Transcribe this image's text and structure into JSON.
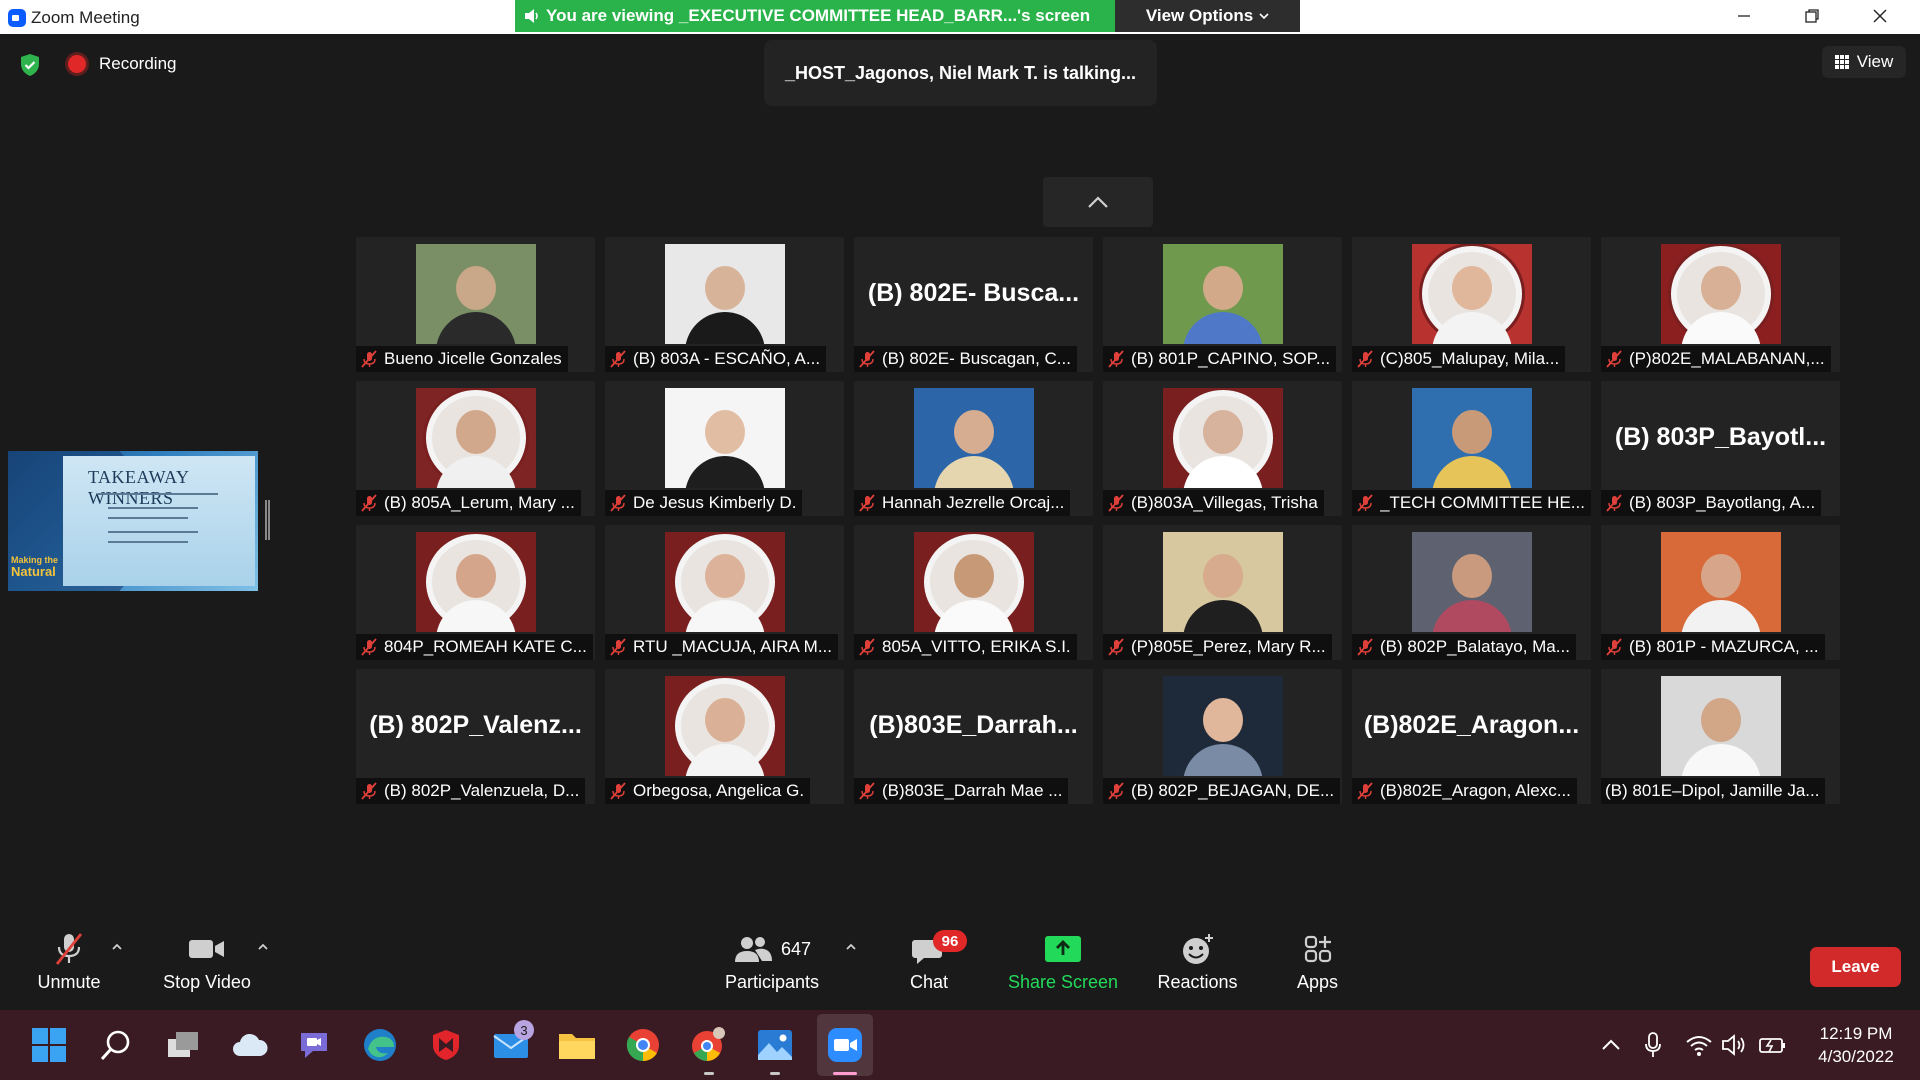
{
  "window": {
    "app_title": "Zoom Meeting",
    "viewing_banner": "You are viewing _EXECUTIVE COMMITTEE HEAD_BARR...'s screen",
    "view_options_label": "View Options",
    "minimize_icon": "minimize-icon",
    "maximize_icon": "restore-icon",
    "close_icon": "close-icon"
  },
  "overlay": {
    "recording_label": "Recording",
    "talking_text": "_HOST_Jagonos, Niel Mark T. is talking...",
    "view_label": "View"
  },
  "share_thumbnail": {
    "title": "TAKEAWAY WINNERS",
    "brand_line1": "Making the",
    "brand_line2": "Natural"
  },
  "participants": [
    {
      "name": "Bueno Jicelle Gonzales",
      "muted": true,
      "avatar": "photo"
    },
    {
      "name": "(B) 803A - ESCAÑO, A...",
      "muted": true,
      "avatar": "photo"
    },
    {
      "name": "(B) 802E- Buscagan, C...",
      "muted": true,
      "avatar": "text",
      "big_name": "(B) 802E- Busca..."
    },
    {
      "name": "(B) 801P_CAPINO, SOP...",
      "muted": true,
      "avatar": "photo"
    },
    {
      "name": "(C)805_Malupay, Mila...",
      "muted": true,
      "avatar": "photo"
    },
    {
      "name": "(P)802E_MALABANAN,...",
      "muted": true,
      "avatar": "photo"
    },
    {
      "name": "(B) 805A_Lerum, Mary ...",
      "muted": true,
      "avatar": "photo"
    },
    {
      "name": "De Jesus Kimberly D.",
      "muted": true,
      "avatar": "photo"
    },
    {
      "name": "Hannah Jezrelle Orcaj...",
      "muted": true,
      "avatar": "photo"
    },
    {
      "name": "(B)803A_Villegas, Trisha",
      "muted": true,
      "avatar": "photo"
    },
    {
      "name": "_TECH COMMITTEE HE...",
      "muted": true,
      "avatar": "photo"
    },
    {
      "name": "(B) 803P_Bayotlang, A...",
      "muted": true,
      "avatar": "text",
      "big_name": "(B)  803P_Bayotl..."
    },
    {
      "name": "804P_ROMEAH KATE C...",
      "muted": true,
      "avatar": "photo"
    },
    {
      "name": "RTU _MACUJA, AIRA M...",
      "muted": true,
      "avatar": "photo"
    },
    {
      "name": "805A_VITTO, ERIKA S.I.",
      "muted": true,
      "avatar": "photo"
    },
    {
      "name": "(P)805E_Perez, Mary R...",
      "muted": true,
      "avatar": "photo"
    },
    {
      "name": "(B) 802P_Balatayo, Ma...",
      "muted": true,
      "avatar": "photo"
    },
    {
      "name": "(B) 801P - MAZURCA, ...",
      "muted": true,
      "avatar": "photo"
    },
    {
      "name": "(B) 802P_Valenzuela, D...",
      "muted": true,
      "avatar": "text",
      "big_name": "(B)  802P_Valenz..."
    },
    {
      "name": "Orbegosa, Angelica G.",
      "muted": true,
      "avatar": "photo"
    },
    {
      "name": "(B)803E_Darrah Mae ...",
      "muted": true,
      "avatar": "text",
      "big_name": "(B)803E_Darrah..."
    },
    {
      "name": "(B) 802P_BEJAGAN, DE...",
      "muted": true,
      "avatar": "photo"
    },
    {
      "name": "(B)802E_Aragon, Alexc...",
      "muted": true,
      "avatar": "text",
      "big_name": "(B)802E_Aragon..."
    },
    {
      "name": "(B) 801E–Dipol, Jamille Ja...",
      "muted": false,
      "avatar": "photo"
    }
  ],
  "toolbar": {
    "unmute_label": "Unmute",
    "stop_video_label": "Stop Video",
    "participants_label": "Participants",
    "participants_count": "647",
    "chat_label": "Chat",
    "chat_badge": "96",
    "share_screen_label": "Share Screen",
    "reactions_label": "Reactions",
    "apps_label": "Apps",
    "leave_label": "Leave"
  },
  "taskbar": {
    "mail_badge": "3",
    "time": "12:19 PM",
    "date": "4/30/2022"
  },
  "colors": {
    "banner_green": "#29b34a",
    "share_green": "#23d959",
    "leave_red": "#d22a2a",
    "mute_red": "#e0403a"
  }
}
